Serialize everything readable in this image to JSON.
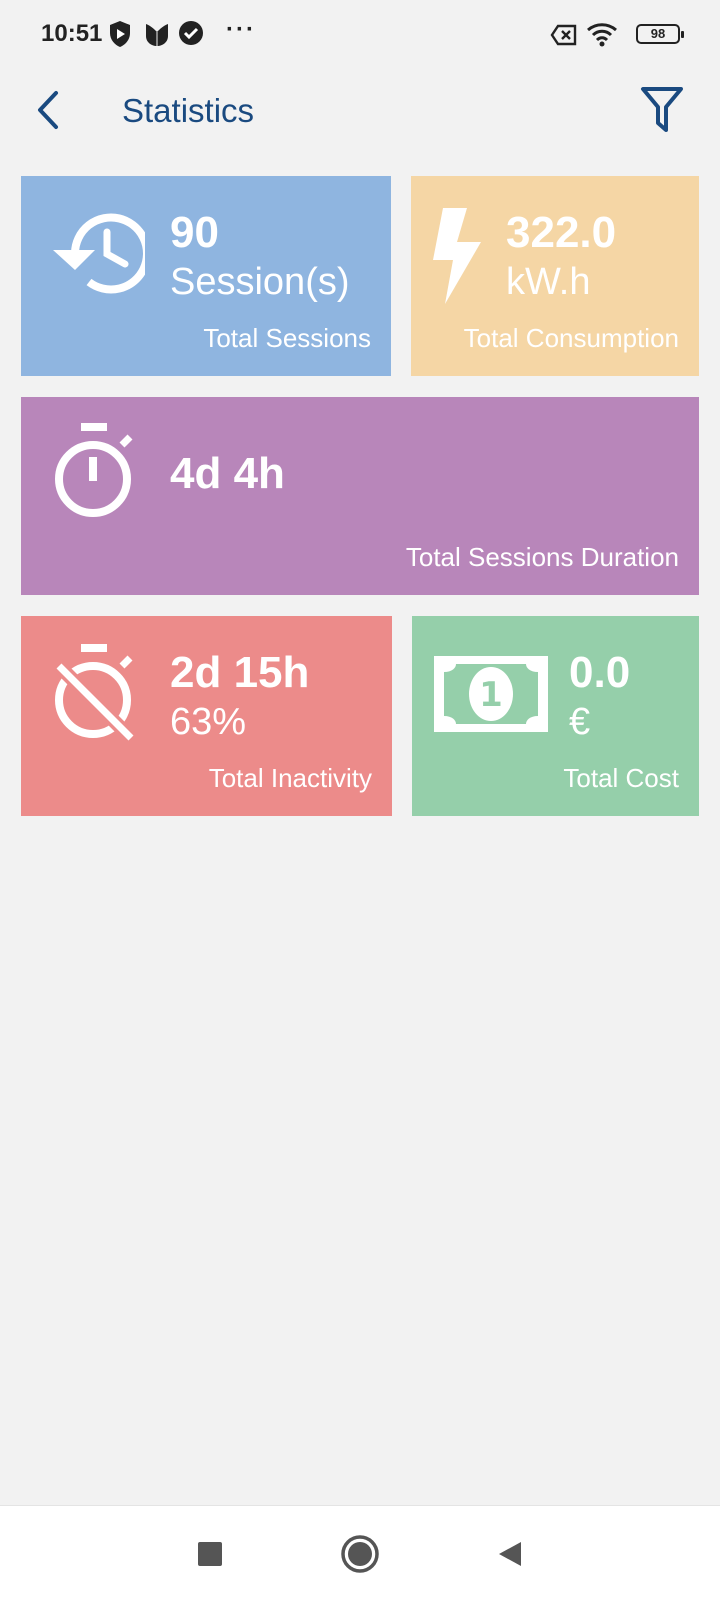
{
  "status_bar": {
    "time": "10:51",
    "icons": [
      "shield-play-icon",
      "tulip-icon",
      "check-circle-icon"
    ],
    "more": "···",
    "right_icons": [
      "sim-off-icon",
      "wifi-icon"
    ],
    "battery": "98"
  },
  "header": {
    "title": "Statistics",
    "back_icon": "chevron-left-icon",
    "filter_icon": "filter-icon"
  },
  "cards": {
    "sessions": {
      "value": "90",
      "unit": "Session(s)",
      "label": "Total Sessions",
      "color": "#8fb5e0",
      "icon": "history-icon"
    },
    "consumption": {
      "value": "322.0",
      "unit": "kW.h",
      "label": "Total Consumption",
      "color": "#f5d6a5",
      "icon": "lightning-icon"
    },
    "duration": {
      "value": "4d 4h",
      "label": "Total Sessions Duration",
      "color": "#b886ba",
      "icon": "stopwatch-icon"
    },
    "inactivity": {
      "value": "2d 15h",
      "unit": "63%",
      "label": "Total Inactivity",
      "color": "#ec8b8a",
      "icon": "stopwatch-off-icon"
    },
    "cost": {
      "value": "0.0",
      "unit": "€",
      "label": "Total Cost",
      "color": "#95cfaa",
      "icon": "banknote-icon"
    }
  },
  "nav": {
    "recents_icon": "square-icon",
    "home_icon": "circle-icon",
    "back_icon": "triangle-back-icon"
  }
}
